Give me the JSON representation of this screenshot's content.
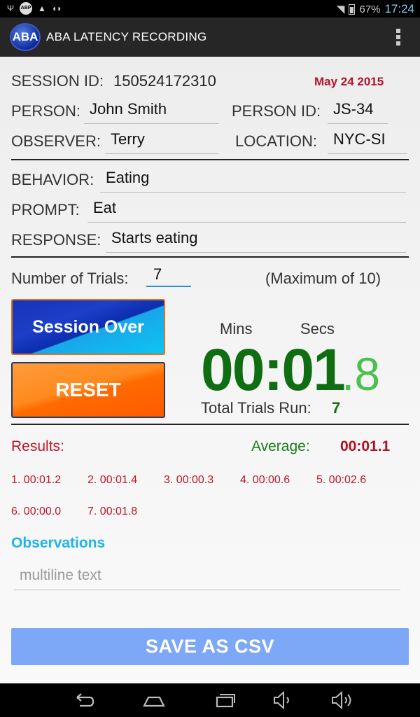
{
  "status_bar": {
    "battery": "67%",
    "time": "17:24",
    "abp_label": "ABP",
    "icons": [
      "usb-icon",
      "adblock-icon",
      "warning-icon",
      "android-icon",
      "wifi-icon",
      "battery-icon"
    ]
  },
  "action_bar": {
    "logo_text": "ABA",
    "title": "ABA LATENCY RECORDING",
    "menu_icon": "overflow-menu-icon"
  },
  "session": {
    "id_label": "SESSION ID:",
    "id_value": "150524172310",
    "date": "May 24 2015"
  },
  "person": {
    "label": "PERSON:",
    "value": "John Smith",
    "id_label": "PERSON ID:",
    "id_value": "JS-34"
  },
  "observer": {
    "label": "OBSERVER:",
    "value": "Terry",
    "location_label": "LOCATION:",
    "location_value": "NYC-SI"
  },
  "behavior": {
    "label": "BEHAVIOR:",
    "value": "Eating"
  },
  "prompt": {
    "label": "PROMPT:",
    "value": "Eat"
  },
  "response": {
    "label": "RESPONSE:",
    "value": "Starts eating"
  },
  "trials": {
    "label": "Number of Trials:",
    "value": "7",
    "max_note": "(Maximum of 10)"
  },
  "buttons": {
    "session_over": "Session Over",
    "reset": "RESET",
    "save": "SAVE AS CSV"
  },
  "timer": {
    "mins_label": "Mins",
    "secs_label": "Secs",
    "main": "00:01",
    "fraction": ".8",
    "total_label": "Total Trials Run:",
    "total_value": "7"
  },
  "results": {
    "label": "Results:",
    "average_label": "Average:",
    "average_value": "00:01.1",
    "items": [
      "1. 00:01.2",
      "2. 00:01.4",
      "3. 00:00.3",
      "4. 00:00.6",
      "5. 00:02.6",
      "6. 00:00.0",
      "7. 00:01.8"
    ]
  },
  "observations": {
    "label": "Observations",
    "placeholder": "multiline text"
  },
  "nav": [
    "back-icon",
    "home-icon",
    "recents-icon",
    "volume-down-icon",
    "volume-up-icon"
  ]
}
